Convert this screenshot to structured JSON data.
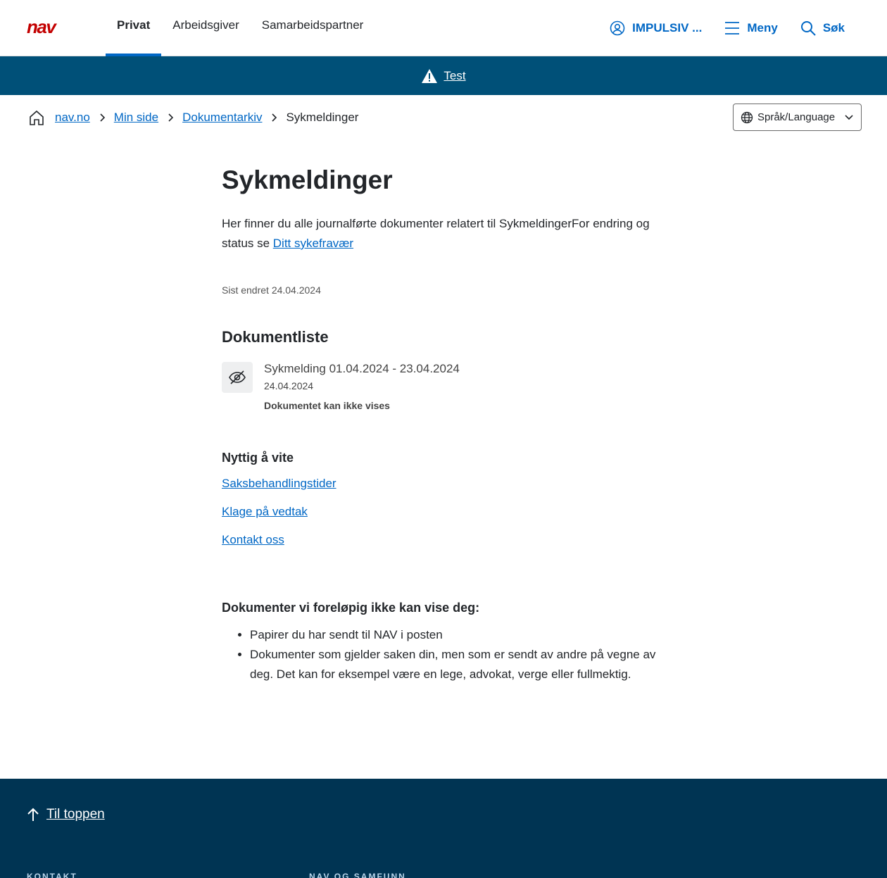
{
  "header": {
    "logo_text": "nav",
    "tabs": [
      {
        "label": "Privat",
        "active": true
      },
      {
        "label": "Arbeidsgiver",
        "active": false
      },
      {
        "label": "Samarbeidspartner",
        "active": false
      }
    ],
    "user_label": "IMPULSIV ...",
    "menu_label": "Meny",
    "search_label": "Søk",
    "accent_color": "#0067c5",
    "logo_color": "#c30000"
  },
  "banner": {
    "link_text": "Test",
    "background": "#005078"
  },
  "breadcrumb": {
    "items": [
      "nav.no",
      "Min side",
      "Dokumentarkiv"
    ],
    "current": "Sykmeldinger"
  },
  "language": {
    "label": "Språk/Language"
  },
  "main": {
    "title": "Sykmeldinger",
    "intro_text": "Her finner du alle journalførte dokumenter relatert til SykmeldingerFor endring og status se ",
    "intro_link": "Ditt sykefravær",
    "last_updated": "Sist endret 24.04.2024",
    "doclist_heading": "Dokumentliste",
    "documents": [
      {
        "title": "Sykmelding 01.04.2024 - 23.04.2024",
        "date": "24.04.2024",
        "note": "Dokumentet kan ikke vises",
        "icon": "eye-slash-icon"
      }
    ],
    "useful_heading": "Nyttig å vite",
    "useful_links": [
      "Saksbehandlingstider",
      "Klage på vedtak",
      "Kontakt oss"
    ],
    "not_shown_heading": "Dokumenter vi foreløpig ikke kan vise deg:",
    "not_shown_items": [
      "Papirer du har sendt til NAV i posten",
      "Dokumenter som gjelder saken din, men som er sendt av andre på vegne av deg. Det kan for eksempel være en lege, advokat, verge eller fullmektig."
    ]
  },
  "footer": {
    "to_top_label": "Til toppen",
    "col1_heading": "KONTAKT",
    "col2_heading": "NAV OG SAMFUNN",
    "background": "#003453"
  }
}
